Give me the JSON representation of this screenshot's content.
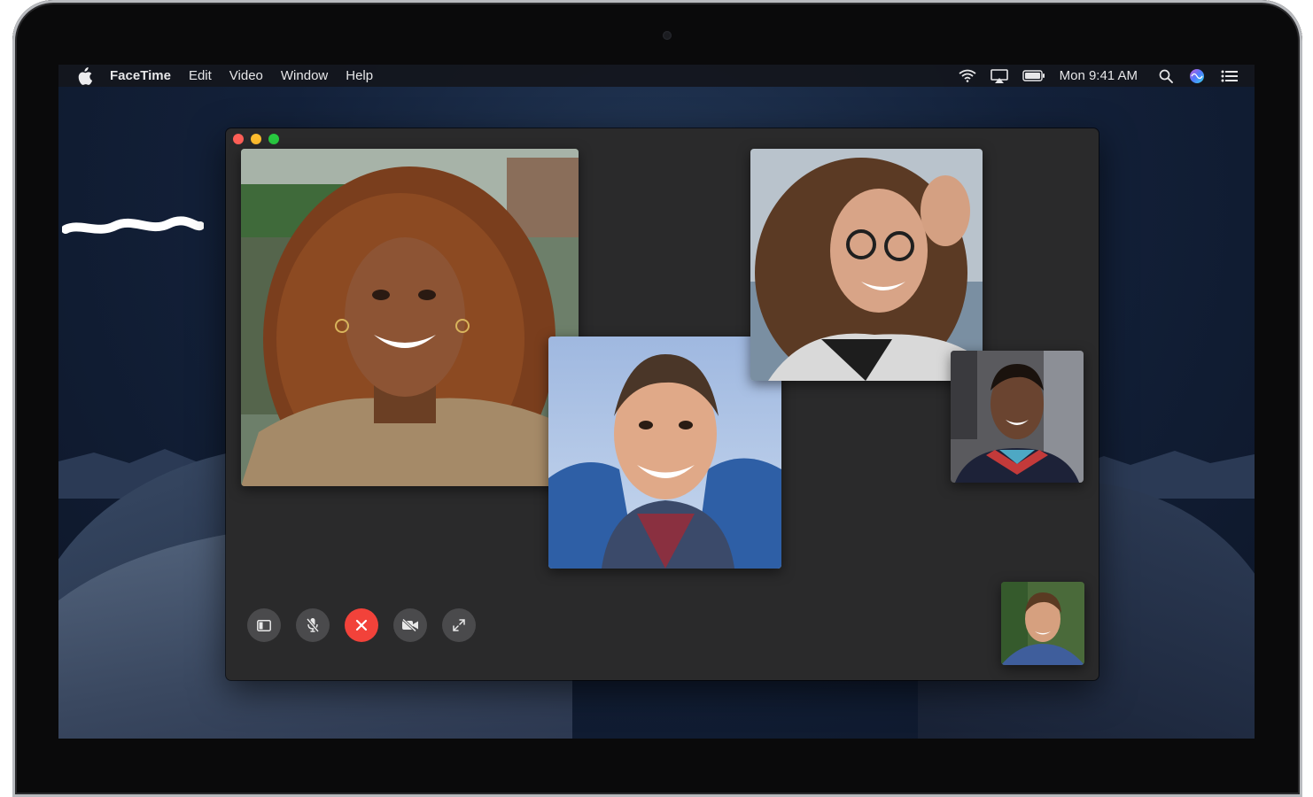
{
  "menubar": {
    "app_name": "FaceTime",
    "menus": [
      "Edit",
      "Video",
      "Window",
      "Help"
    ],
    "clock": "Mon 9:41 AM",
    "status_icons": [
      "wifi-icon",
      "airplay-icon",
      "battery-icon",
      "search-icon",
      "siri-icon",
      "notification-center-icon"
    ]
  },
  "window": {
    "traffic_lights": [
      "close",
      "minimize",
      "zoom"
    ],
    "participants": [
      {
        "id": "participant-curly-hair-woman"
      },
      {
        "id": "participant-young-man-smiling"
      },
      {
        "id": "participant-woman-glasses"
      },
      {
        "id": "participant-man-red-collar"
      },
      {
        "id": "self-view"
      }
    ],
    "controls": [
      "sidebar-icon",
      "mute-microphone-icon",
      "end-call-icon",
      "camera-off-icon",
      "fullscreen-icon"
    ]
  },
  "colors": {
    "end_call": "#f2423a",
    "control_bg": "#4a4a4c",
    "window_bg": "#2a2a2b",
    "close": "#fe5f57",
    "minimize": "#febc2e",
    "zoom": "#28c840"
  }
}
